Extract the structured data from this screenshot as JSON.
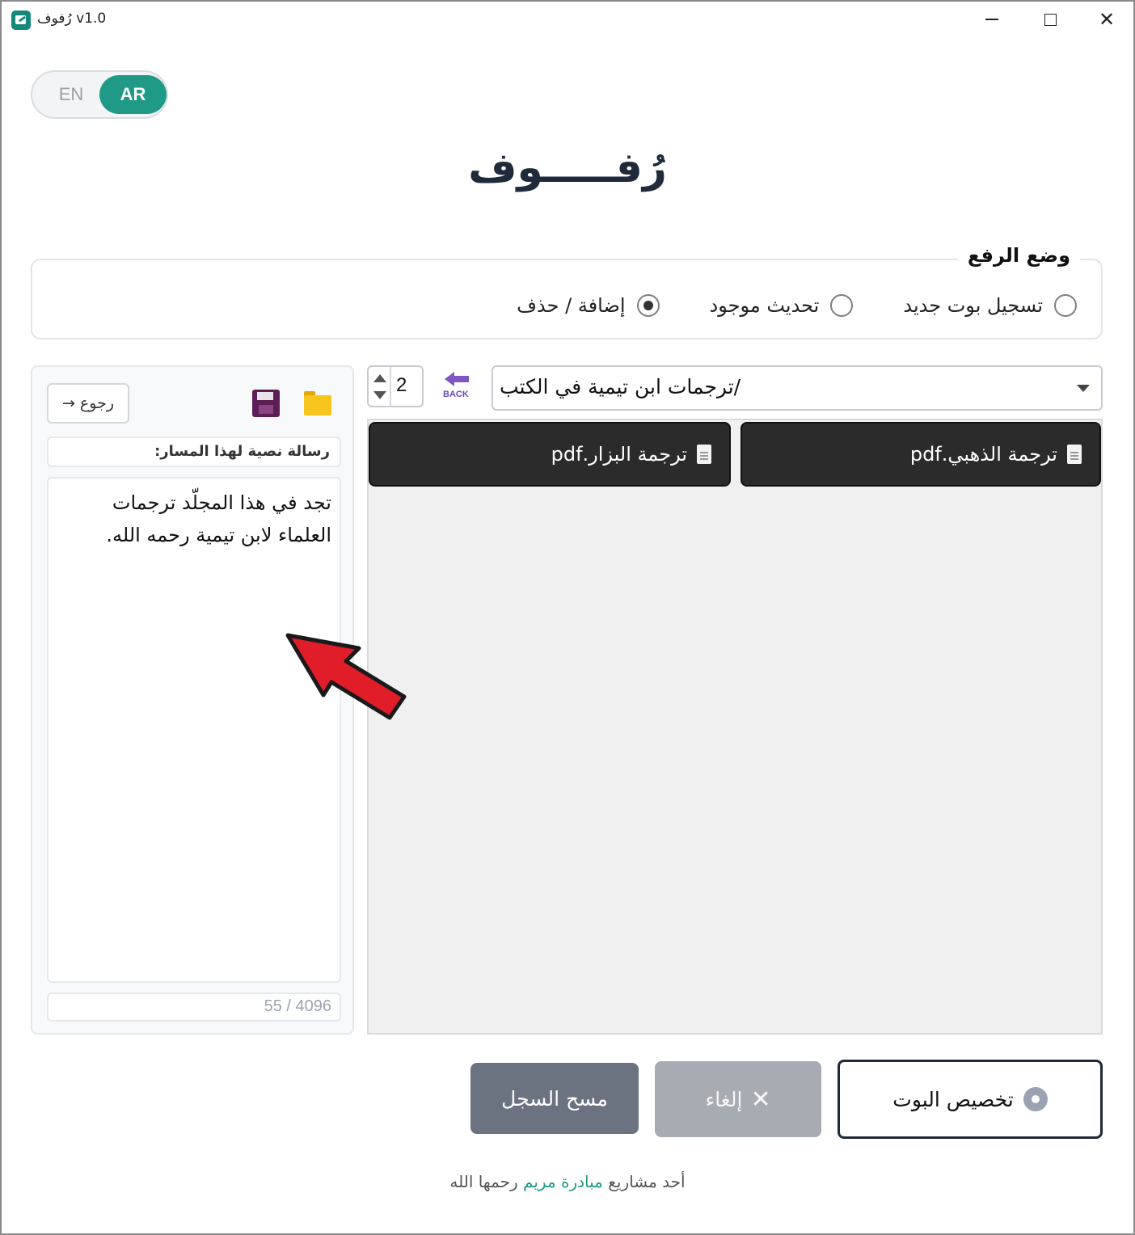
{
  "window": {
    "title": "رُفوف v1.0"
  },
  "lang": {
    "en": "EN",
    "ar": "AR",
    "active": "AR"
  },
  "app": {
    "title": "رُفـــــوف"
  },
  "upload_mode": {
    "legend": "وضع الرفع",
    "options": [
      {
        "label": "تسجيل بوت جديد",
        "checked": false
      },
      {
        "label": "تحديث موجود",
        "checked": false
      },
      {
        "label": "إضافة / حذف",
        "checked": true
      }
    ]
  },
  "left_panel": {
    "back_label": "رجوع",
    "back_arrow": "→",
    "message_label": "رسالة نصية لهذا المسار:",
    "message_text": "تجد في هذا المجلّد ترجمات العلماء لابن تيمية رحمه الله.",
    "char_count": "55 / 4096"
  },
  "nav": {
    "depth_value": "2",
    "back_label": "BACK",
    "path": "/ترجمات ابن تيمية في الكتب"
  },
  "files": [
    {
      "name": "ترجمة الذهبي.pdf"
    },
    {
      "name": "ترجمة البزار.pdf"
    }
  ],
  "actions": {
    "clear_log": "مسح السجل",
    "cancel": "إلغاء",
    "cancel_icon": "✕",
    "customize": "تخصيص البوت"
  },
  "footer": {
    "prefix": "أحد مشاريع",
    "link": "مبادرة مريم",
    "suffix": "رحمها الله"
  },
  "colors": {
    "accent": "#1e9a86",
    "file_card": "#2b2b2b",
    "clear_btn": "#6b7280",
    "cancel_btn": "#a7abb2",
    "annotation_arrow": "#e11d2a"
  }
}
